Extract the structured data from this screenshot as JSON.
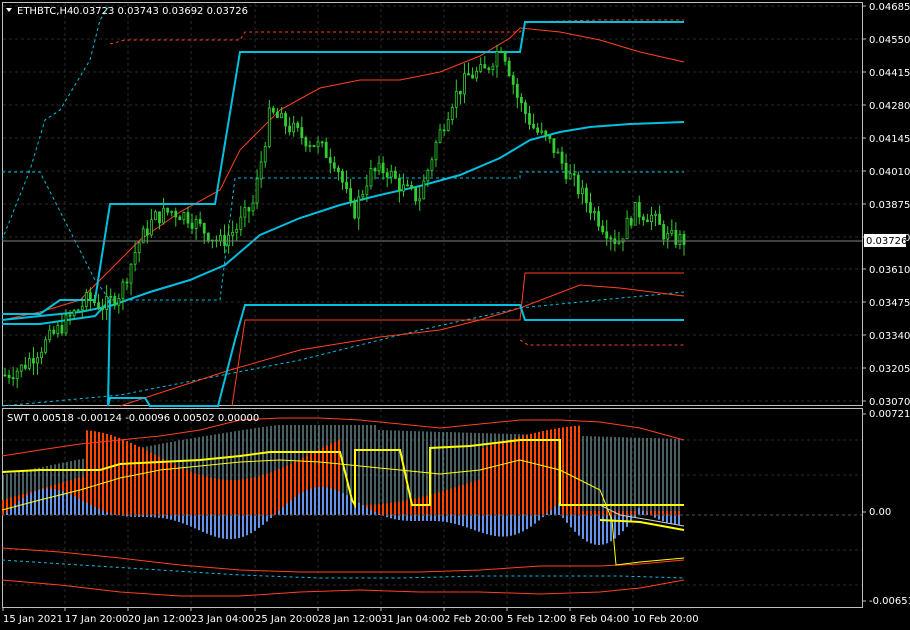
{
  "header": {
    "symbol": "ETHBTC,H4",
    "ohlc": "0.03723 0.03743 0.03692 0.03726"
  },
  "price_axis": {
    "ticks": [
      "0.04685",
      "0.04550",
      "0.04415",
      "0.04280",
      "0.04145",
      "0.04010",
      "0.03875",
      "0.03740",
      "0.03610",
      "0.03475",
      "0.03340",
      "0.03205",
      "0.03070"
    ],
    "current_price": "0.03726"
  },
  "indicator": {
    "label": "SWT 0.00518 -0.00124 -0.00096 0.00502 0.00000",
    "ticks": [
      "0.00721",
      "0.00",
      "-0.00651"
    ]
  },
  "time_axis": {
    "labels": [
      "15 Jan 2021",
      "17 Jan 20:00",
      "20 Jan 12:00",
      "23 Jan 04:00",
      "25 Jan 20:00",
      "28 Jan 12:00",
      "31 Jan 04:00",
      "2 Feb 20:00",
      "5 Feb 12:00",
      "8 Feb 04:00",
      "10 Feb 20:00"
    ]
  },
  "colors": {
    "candle": "#32cd32",
    "cyan": "#00c0e0",
    "channel_red": "#ff4020",
    "histogram_red": "#ff4500",
    "histogram_blue": "#6495ed",
    "signal_yellow": "#ffff00",
    "grid": "#2a2a2a"
  },
  "chart_data": [
    {
      "type": "line",
      "title": "ETHBTC,H4",
      "series": [
        {
          "name": "ETHBTC,H4",
          "values": [
            0.0318,
            0.0321,
            0.0328,
            0.0335,
            0.0342,
            0.0349,
            0.0346,
            0.0352,
            0.0371,
            0.0382,
            0.0385,
            0.0383,
            0.0377,
            0.0372,
            0.0378,
            0.0388,
            0.0425,
            0.042,
            0.0415,
            0.0411,
            0.0405,
            0.0383,
            0.04,
            0.0402,
            0.0394,
            0.039,
            0.0412,
            0.043,
            0.044,
            0.0442,
            0.0453,
            0.043,
            0.0418,
            0.0412,
            0.04,
            0.039,
            0.038,
            0.0372,
            0.0385,
            0.0383,
            0.0374,
            0.0373
          ]
        }
      ]
    },
    {
      "type": "bar",
      "title": "SWT",
      "series": [
        {
          "name": "SWT",
          "values": [
            0.00518,
            -0.00124,
            -0.00096,
            0.00502,
            0.0
          ]
        }
      ]
    }
  ]
}
